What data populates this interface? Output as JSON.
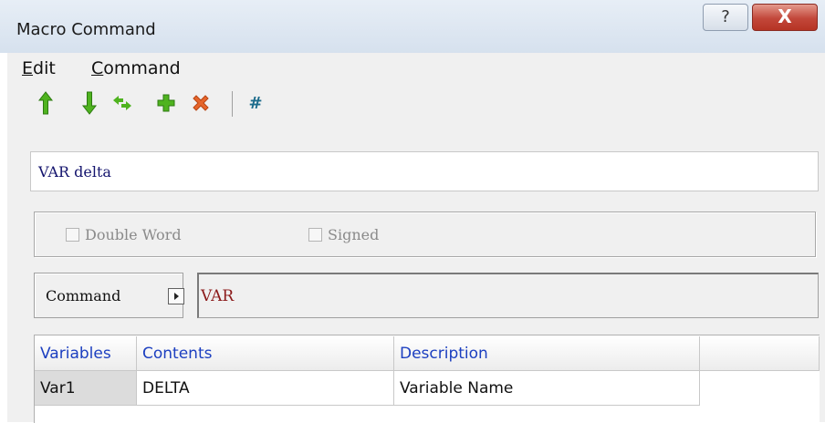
{
  "window": {
    "title": "Macro Command",
    "help_label": "?",
    "close_label": "X"
  },
  "menu": {
    "edit": "Edit",
    "command": "Command"
  },
  "toolbar": {
    "buttons": [
      "move-up",
      "move-down",
      "swap",
      "add",
      "delete"
    ],
    "number_label": "#",
    "colors": {
      "green": "#3aa317",
      "orange": "#e6652b",
      "teal": "#1d6c8c"
    }
  },
  "editor": {
    "line": "VAR delta"
  },
  "options": {
    "double_word": "Double Word",
    "signed": "Signed"
  },
  "command": {
    "button_label": "Command",
    "value": "VAR"
  },
  "grid": {
    "headers": [
      "Variables",
      "Contents",
      "Description"
    ],
    "rows": [
      {
        "name": "Var1",
        "contents": "DELTA",
        "description": "Variable Name"
      }
    ]
  }
}
